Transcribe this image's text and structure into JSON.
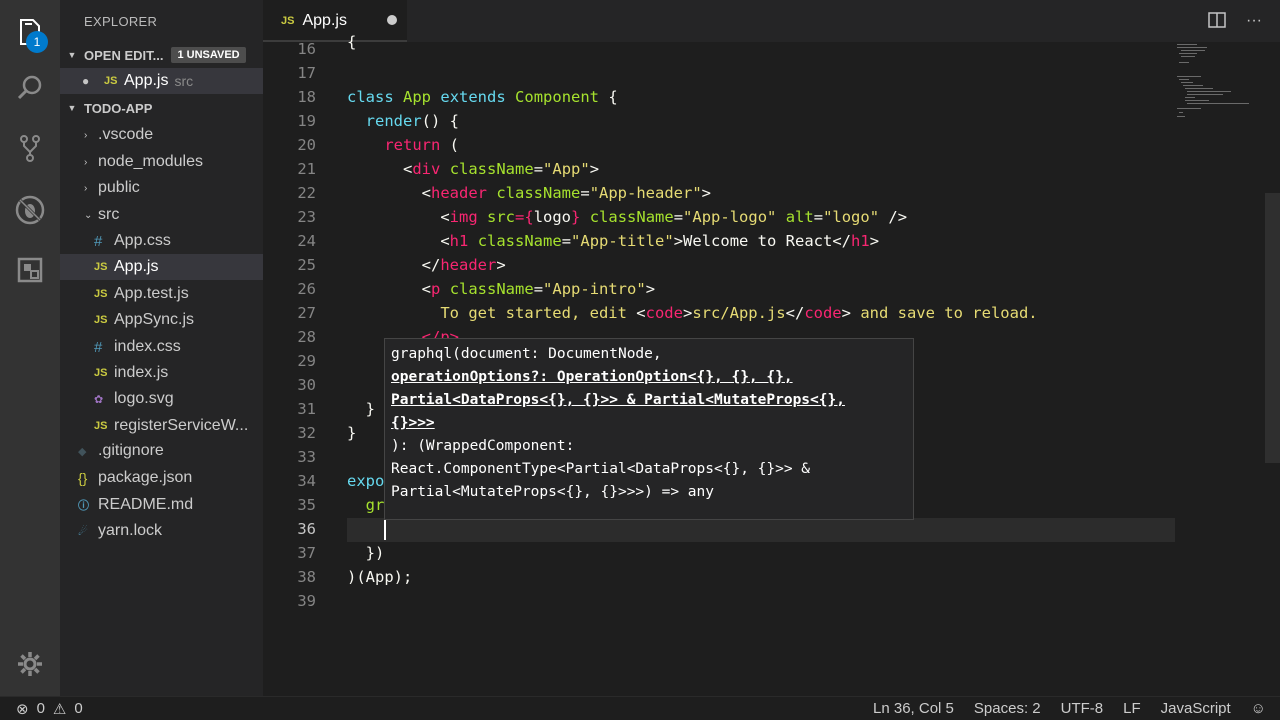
{
  "sidebar": {
    "title": "EXPLORER",
    "open_editors": {
      "label": "OPEN EDIT...",
      "badge": "1 UNSAVED",
      "item": {
        "name": "App.js",
        "folder": "src",
        "icon": "JS"
      }
    },
    "project": {
      "label": "TODO-APP"
    },
    "items": [
      {
        "name": ".vscode",
        "icon": "chevron-right"
      },
      {
        "name": "node_modules",
        "icon": "chevron-right"
      },
      {
        "name": "public",
        "icon": "chevron-right"
      },
      {
        "name": "src",
        "icon": "chevron-down"
      },
      {
        "name": "App.css",
        "icon": "#"
      },
      {
        "name": "App.js",
        "icon": "JS"
      },
      {
        "name": "App.test.js",
        "icon": "JS"
      },
      {
        "name": "AppSync.js",
        "icon": "JS"
      },
      {
        "name": "index.css",
        "icon": "#"
      },
      {
        "name": "index.js",
        "icon": "JS"
      },
      {
        "name": "logo.svg",
        "icon": "svg"
      },
      {
        "name": "registerServiceW...",
        "icon": "JS"
      },
      {
        "name": ".gitignore",
        "icon": "git"
      },
      {
        "name": "package.json",
        "icon": "{}"
      },
      {
        "name": "README.md",
        "icon": "i"
      },
      {
        "name": "yarn.lock",
        "icon": "yarn"
      }
    ]
  },
  "activity": {
    "badge": "1"
  },
  "tab": {
    "label": "App.js",
    "icon": "JS"
  },
  "editor": {
    "line_numbers": [
      "16",
      "17",
      "18",
      "19",
      "20",
      "21",
      "22",
      "23",
      "24",
      "25",
      "26",
      "27",
      "28",
      "29",
      "30",
      "31",
      "32",
      "33",
      "34",
      "35",
      "36",
      "37",
      "38",
      "39"
    ],
    "lines": {
      "l16": "{",
      "l18": {
        "a": "class",
        "b": "App",
        "c": "extends",
        "d": "Component",
        "e": "{"
      },
      "l19": {
        "a": "render",
        "b": "() {"
      },
      "l20": {
        "a": "return",
        "b": "("
      },
      "l21": {
        "a": "<",
        "b": "div",
        "c": "className",
        "d": "=",
        "e": "\"App\"",
        "f": ">"
      },
      "l22": {
        "a": "<",
        "b": "header",
        "c": "className",
        "d": "=",
        "e": "\"App-header\"",
        "f": ">"
      },
      "l23": {
        "a": "<",
        "b": "img",
        "c": "src",
        "d": "={",
        "e": "logo",
        "f": "}",
        "g": "className",
        "h": "=",
        "i": "\"App-logo\"",
        "j": "alt",
        "k": "=",
        "l": "\"logo\"",
        "m": "/>"
      },
      "l24": {
        "a": "<",
        "b": "h1",
        "c": "className",
        "d": "=",
        "e": "\"App-title\"",
        "f": ">",
        "g": "Welcome to React",
        "h": "</",
        "i": "h1",
        "j": ">"
      },
      "l25": {
        "a": "</",
        "b": "header",
        "c": ">"
      },
      "l26": {
        "a": "<",
        "b": "p",
        "c": "className",
        "d": "=",
        "e": "\"App-intro\"",
        "f": ">"
      },
      "l27": {
        "a": "To get started, edit ",
        "b": "<",
        "c": "code",
        "d": ">",
        "e": "src/App.js",
        "f": "</",
        "g": "code",
        "h": ">",
        "i": " and save to reload."
      },
      "l28": "</p>",
      "l31": "}",
      "l32": "}",
      "l34": "expo",
      "l35": "gr",
      "l37": "})",
      "l38": {
        "a": ")(",
        "b": "App",
        "c": ");"
      }
    }
  },
  "hover": {
    "lines": [
      "graphql(document: DocumentNode,",
      "operationOptions?: OperationOption<{}, {}, {},",
      "Partial<DataProps<{}, {}>> & Partial<MutateProps<{},",
      "{}>>>",
      "): (WrappedComponent:",
      "React.ComponentType<Partial<DataProps<{}, {}>> &",
      "Partial<MutateProps<{}, {}>>>) => any"
    ]
  },
  "status": {
    "errors": "0",
    "warnings": "0",
    "position": "Ln 36, Col 5",
    "spaces": "Spaces: 2",
    "encoding": "UTF-8",
    "eol": "LF",
    "language": "JavaScript"
  }
}
